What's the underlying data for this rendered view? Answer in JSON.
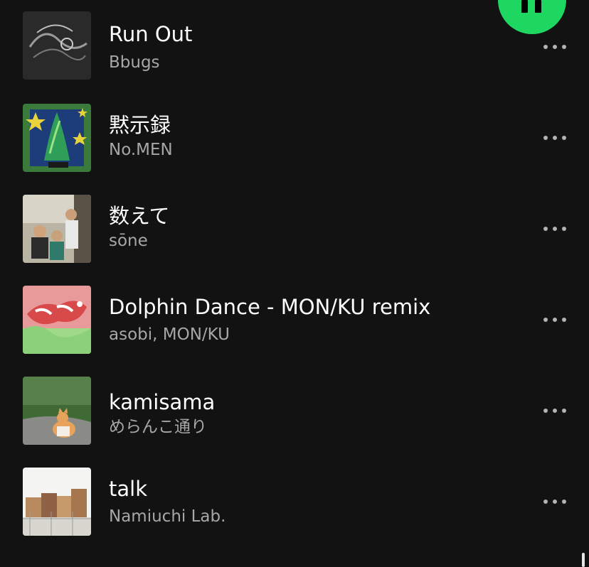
{
  "player": {
    "pause_icon": "pause-icon",
    "accent_color": "#1ed760"
  },
  "tracks": [
    {
      "title": "Run Out",
      "artist": "Bbugs",
      "more_icon": "more-horizontal-icon"
    },
    {
      "title": "黙示録",
      "artist": "No.MEN",
      "more_icon": "more-horizontal-icon"
    },
    {
      "title": "数えて",
      "artist": "sōne",
      "more_icon": "more-horizontal-icon"
    },
    {
      "title": "Dolphin Dance - MON/KU remix",
      "artist": "asobi, MON/KU",
      "more_icon": "more-horizontal-icon"
    },
    {
      "title": "kamisama",
      "artist": "めらんこ通り",
      "more_icon": "more-horizontal-icon"
    },
    {
      "title": "talk",
      "artist": "Namiuchi Lab.",
      "more_icon": "more-horizontal-icon"
    }
  ],
  "colors": {
    "background": "#121212",
    "title_text": "#ffffff",
    "subtitle_text": "#a7a7a7"
  }
}
